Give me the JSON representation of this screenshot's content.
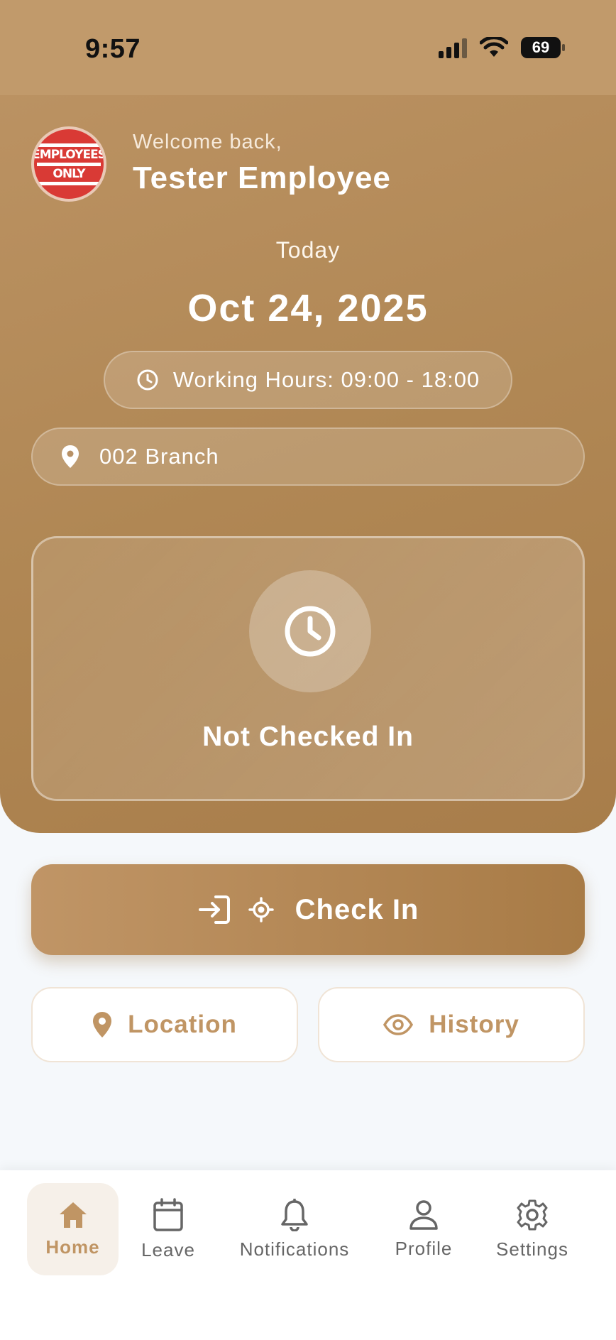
{
  "status_bar": {
    "time": "9:57",
    "battery": "69"
  },
  "header": {
    "avatar_line1": "EMPLOYEES",
    "avatar_line2": "ONLY",
    "welcome": "Welcome back,",
    "name": "Tester Employee"
  },
  "date_section": {
    "label": "Today",
    "date": "Oct 24, 2025",
    "working_hours": "Working Hours: 09:00 - 18:00",
    "branch": "002 Branch"
  },
  "status_card": {
    "status": "Not Checked In"
  },
  "actions": {
    "check_in": "Check In",
    "location": "Location",
    "history": "History"
  },
  "nav": {
    "items": [
      {
        "label": "Home",
        "icon": "home-icon",
        "active": true
      },
      {
        "label": "Leave",
        "icon": "calendar-icon",
        "active": false
      },
      {
        "label": "Notifications",
        "icon": "bell-icon",
        "active": false
      },
      {
        "label": "Profile",
        "icon": "person-icon",
        "active": false
      },
      {
        "label": "Settings",
        "icon": "gear-icon",
        "active": false
      }
    ]
  },
  "colors": {
    "brand": "#b08754",
    "accent_text": "#c09564",
    "background": "#f5f8fb"
  }
}
